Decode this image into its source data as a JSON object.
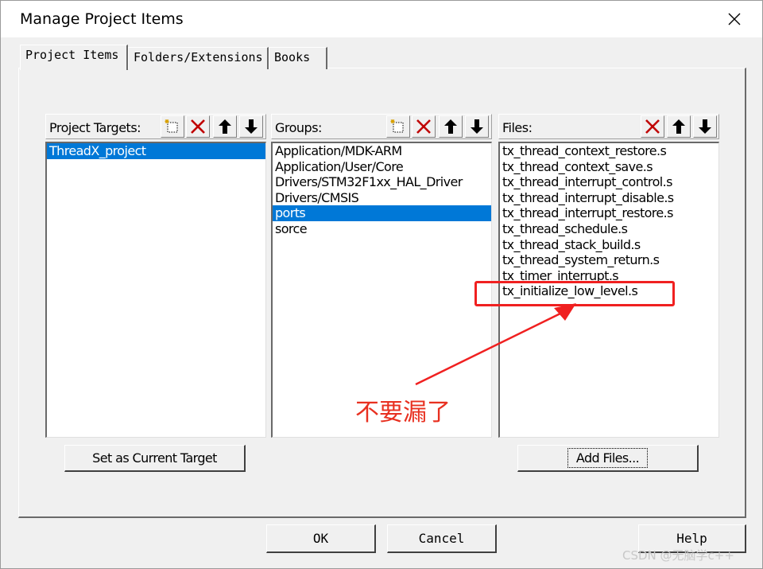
{
  "window": {
    "title": "Manage Project Items"
  },
  "tabs": [
    {
      "label": "Project Items",
      "active": true
    },
    {
      "label": "Folders/Extensions",
      "active": false
    },
    {
      "label": "Books",
      "active": false
    }
  ],
  "targets": {
    "label": "Project Targets:",
    "items": [
      "ThreadX_project"
    ],
    "selected_index": 0
  },
  "groups": {
    "label": "Groups:",
    "items": [
      "Application/MDK-ARM",
      "Application/User/Core",
      "Drivers/STM32F1xx_HAL_Driver",
      "Drivers/CMSIS",
      "ports",
      "sorce"
    ],
    "selected_index": 4
  },
  "files": {
    "label": "Files:",
    "items": [
      "tx_thread_context_restore.s",
      "tx_thread_context_save.s",
      "tx_thread_interrupt_control.s",
      "tx_thread_interrupt_disable.s",
      "tx_thread_interrupt_restore.s",
      "tx_thread_schedule.s",
      "tx_thread_stack_build.s",
      "tx_thread_system_return.s",
      "tx_timer_interrupt.s",
      "tx_initialize_low_level.s"
    ]
  },
  "buttons": {
    "set_current": "Set as Current Target",
    "add_files": "Add Files...",
    "ok": "OK",
    "cancel": "Cancel",
    "help": "Help"
  },
  "annotation": {
    "text": "不要漏了",
    "color": "#e83020"
  },
  "watermark": "CSDN @无脑学c++",
  "colors": {
    "selection": "#0078d7",
    "delete_red": "#c00000",
    "annotation_red": "#f02020"
  }
}
